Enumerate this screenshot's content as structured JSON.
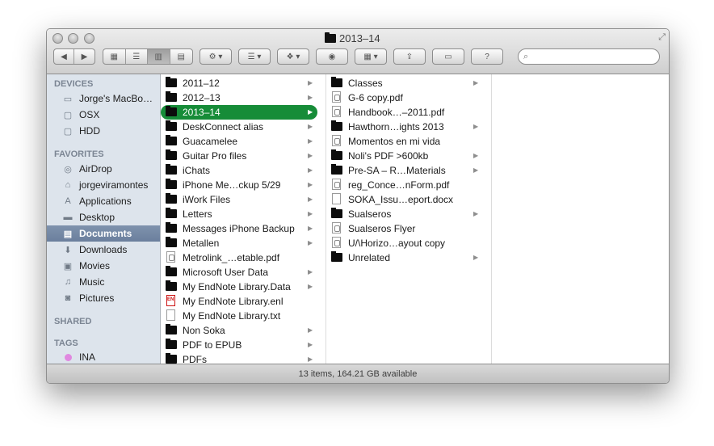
{
  "window": {
    "title": "2013–14"
  },
  "toolbar": {
    "back_icon": "back-arrow-icon",
    "forward_icon": "forward-arrow-icon",
    "views": [
      "icon-view",
      "list-view",
      "column-view",
      "coverflow-view"
    ],
    "action_icon": "gear-icon",
    "arrange_icon": "arrange-icon",
    "dropbox_icon": "dropbox-icon",
    "quicklook_icon": "eye-icon",
    "columns_icon": "columns-icon",
    "share_icon": "share-icon",
    "toggle_icon": "toggle-icon",
    "help_icon": "help-icon",
    "search_placeholder": ""
  },
  "sidebar": {
    "sections": {
      "devices": "DEVICES",
      "favorites": "FAVORITES",
      "shared": "SHARED",
      "tags": "TAGS"
    },
    "devices": [
      {
        "label": "Jorge's MacBo…",
        "icon": "laptop-icon"
      },
      {
        "label": "OSX",
        "icon": "hard-drive-icon"
      },
      {
        "label": "HDD",
        "icon": "hard-drive-icon"
      }
    ],
    "favorites": [
      {
        "label": "AirDrop",
        "icon": "airdrop-icon"
      },
      {
        "label": "jorgeviramontes",
        "icon": "home-icon"
      },
      {
        "label": "Applications",
        "icon": "applications-icon"
      },
      {
        "label": "Desktop",
        "icon": "desktop-icon"
      },
      {
        "label": "Documents",
        "icon": "documents-icon"
      },
      {
        "label": "Downloads",
        "icon": "downloads-icon"
      },
      {
        "label": "Movies",
        "icon": "movies-icon"
      },
      {
        "label": "Music",
        "icon": "music-icon"
      },
      {
        "label": "Pictures",
        "icon": "pictures-icon"
      }
    ],
    "tags": [
      {
        "label": "INA",
        "color": "#e088e0"
      }
    ]
  },
  "column1": [
    {
      "label": "2011–12",
      "type": "folder",
      "arrow": true
    },
    {
      "label": "2012–13",
      "type": "folder",
      "arrow": true
    },
    {
      "label": "2013–14",
      "type": "folder",
      "arrow": true,
      "selected": true
    },
    {
      "label": "DeskConnect alias",
      "type": "folder",
      "arrow": true
    },
    {
      "label": "Guacamelee",
      "type": "folder",
      "arrow": true
    },
    {
      "label": "Guitar Pro files",
      "type": "folder",
      "arrow": true
    },
    {
      "label": "iChats",
      "type": "folder",
      "arrow": true
    },
    {
      "label": "iPhone Me…ckup 5/29",
      "type": "folder",
      "arrow": true
    },
    {
      "label": "iWork Files",
      "type": "folder",
      "arrow": true
    },
    {
      "label": "Letters",
      "type": "folder",
      "arrow": true
    },
    {
      "label": "Messages iPhone Backup",
      "type": "folder",
      "arrow": true
    },
    {
      "label": "Metallen",
      "type": "folder",
      "arrow": true
    },
    {
      "label": "Metrolink_…etable.pdf",
      "type": "pdf",
      "arrow": false
    },
    {
      "label": "Microsoft User Data",
      "type": "folder",
      "arrow": true
    },
    {
      "label": "My EndNote Library.Data",
      "type": "folder",
      "arrow": true
    },
    {
      "label": "My EndNote Library.enl",
      "type": "endnote",
      "arrow": false
    },
    {
      "label": "My EndNote Library.txt",
      "type": "doc",
      "arrow": false
    },
    {
      "label": "Non Soka",
      "type": "folder",
      "arrow": true
    },
    {
      "label": "PDF to EPUB",
      "type": "folder",
      "arrow": true
    },
    {
      "label": "PDFs",
      "type": "folder",
      "arrow": true
    }
  ],
  "column2": [
    {
      "label": "Classes",
      "type": "folder",
      "arrow": true
    },
    {
      "label": "G-6 copy.pdf",
      "type": "pdf",
      "arrow": false
    },
    {
      "label": "Handbook…–2011.pdf",
      "type": "pdf",
      "arrow": false
    },
    {
      "label": "Hawthorn…ights 2013",
      "type": "folder",
      "arrow": true
    },
    {
      "label": "Momentos en mi vida",
      "type": "pdf",
      "arrow": false
    },
    {
      "label": "Noli's PDF >600kb",
      "type": "folder",
      "arrow": true
    },
    {
      "label": "Pre-SA – R…Materials",
      "type": "folder",
      "arrow": true
    },
    {
      "label": "reg_Conce…nForm.pdf",
      "type": "pdf",
      "arrow": false
    },
    {
      "label": "SOKA_Issu…eport.docx",
      "type": "doc",
      "arrow": false
    },
    {
      "label": "Sualseros",
      "type": "folder",
      "arrow": true
    },
    {
      "label": "Sualseros Flyer",
      "type": "pdf",
      "arrow": false
    },
    {
      "label": "U/\\Horizo…ayout copy",
      "type": "pdf",
      "arrow": false
    },
    {
      "label": "Unrelated",
      "type": "folder",
      "arrow": true
    }
  ],
  "status": {
    "text": "13 items, 164.21 GB available"
  }
}
